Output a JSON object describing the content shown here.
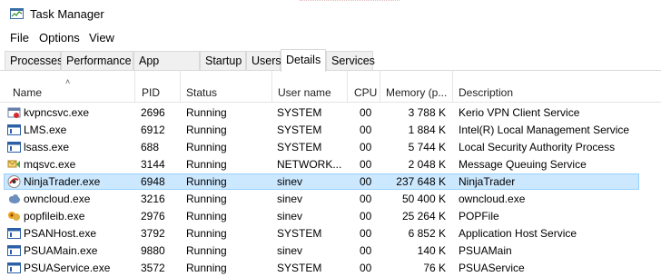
{
  "window": {
    "title": "Task Manager"
  },
  "menu": [
    "File",
    "Options",
    "View"
  ],
  "tabs": [
    "Processes",
    "Performance",
    "App history",
    "Startup",
    "Users",
    "Details",
    "Services"
  ],
  "active_tab": "Details",
  "columns": {
    "name": "Name",
    "pid": "PID",
    "status": "Status",
    "user": "User name",
    "cpu": "CPU",
    "memory": "Memory (p...",
    "description": "Description"
  },
  "sort": {
    "column": "Name",
    "direction": "ascending"
  },
  "rows": [
    {
      "name": "kvpncsvc.exe",
      "pid": "2696",
      "status": "Running",
      "user": "SYSTEM",
      "cpu": "00",
      "memory": "3 788 K",
      "description": "Kerio VPN Client Service",
      "icon": "vpn-service-icon"
    },
    {
      "name": "LMS.exe",
      "pid": "6912",
      "status": "Running",
      "user": "SYSTEM",
      "cpu": "00",
      "memory": "1 884 K",
      "description": "Intel(R) Local Management Service",
      "icon": "generic-window-icon"
    },
    {
      "name": "lsass.exe",
      "pid": "688",
      "status": "Running",
      "user": "SYSTEM",
      "cpu": "00",
      "memory": "5 744 K",
      "description": "Local Security Authority Process",
      "icon": "generic-window-icon"
    },
    {
      "name": "mqsvc.exe",
      "pid": "3144",
      "status": "Running",
      "user": "NETWORK...",
      "cpu": "00",
      "memory": "2 048 K",
      "description": "Message Queuing Service",
      "icon": "message-queue-icon"
    },
    {
      "name": "NinjaTrader.exe",
      "pid": "6948",
      "status": "Running",
      "user": "sinev",
      "cpu": "00",
      "memory": "237 648 K",
      "description": "NinjaTrader",
      "icon": "ninjatrader-icon",
      "selected": true
    },
    {
      "name": "owncloud.exe",
      "pid": "3216",
      "status": "Running",
      "user": "sinev",
      "cpu": "00",
      "memory": "50 400 K",
      "description": "owncloud.exe",
      "icon": "cloud-icon"
    },
    {
      "name": "popfileib.exe",
      "pid": "2976",
      "status": "Running",
      "user": "sinev",
      "cpu": "00",
      "memory": "25 264 K",
      "description": "POPFile",
      "icon": "popfile-icon"
    },
    {
      "name": "PSANHost.exe",
      "pid": "3792",
      "status": "Running",
      "user": "SYSTEM",
      "cpu": "00",
      "memory": "6 852 K",
      "description": "Application Host Service",
      "icon": "generic-window-icon"
    },
    {
      "name": "PSUAMain.exe",
      "pid": "9880",
      "status": "Running",
      "user": "sinev",
      "cpu": "00",
      "memory": "140 K",
      "description": "PSUAMain",
      "icon": "generic-window-icon"
    },
    {
      "name": "PSUAService.exe",
      "pid": "3572",
      "status": "Running",
      "user": "SYSTEM",
      "cpu": "00",
      "memory": "76 K",
      "description": "PSUAService",
      "icon": "generic-window-icon"
    }
  ]
}
